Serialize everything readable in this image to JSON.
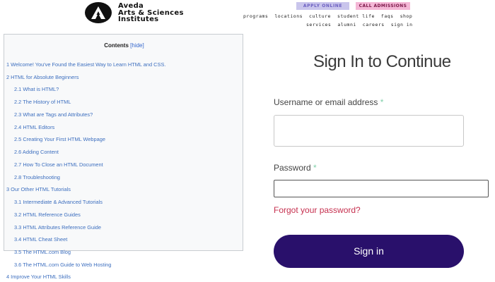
{
  "header": {
    "logo_line1": "Aveda",
    "logo_line2": "Arts & Sciences",
    "logo_line3": "Institutes",
    "apply_label": "APPLY ONLINE",
    "call_label": "CALL ADMISSIONS",
    "nav_row1": [
      "programs",
      "locations",
      "culture",
      "student life",
      "faqs",
      "shop"
    ],
    "nav_row2": [
      "services",
      "alumni",
      "careers",
      "sign in"
    ],
    "colors": {
      "apply_bg": "#c9c5ec",
      "call_bg": "#f4b7d6"
    }
  },
  "toc": {
    "title": "Contents",
    "hide_label": "[hide]",
    "items": [
      "1 Welcome! You've Found the Easiest Way to Learn HTML and CSS.",
      "2 HTML for Absolute Beginners",
      "2.1 What is HTML?",
      "2.2 The History of HTML",
      "2.3 What are Tags and Attributes?",
      "2.4 HTML Editors",
      "2.5 Creating Your First HTML Webpage",
      "2.6 Adding Content",
      "2.7 How To Close an HTML Document",
      "2.8 Troubleshooting",
      "3 Our Other HTML Tutorials",
      "3.1 Intermediate & Advanced Tutorials",
      "3.2 HTML Reference Guides",
      "3.3 HTML Attributes Reference Guide",
      "3.4 HTML Cheat Sheet",
      "3.5 The HTML.com Blog",
      "3.6 The HTML.com Guide to Web Hosting",
      "4 Improve Your HTML Skills"
    ]
  },
  "signin": {
    "title": "Sign In to Continue",
    "username_label": "Username or email address",
    "password_label": "Password",
    "required_mark": "*",
    "username_value": "",
    "password_value": "",
    "forgot_label": "Forgot your password?",
    "button_label": "Sign in",
    "colors": {
      "button": "#29106b",
      "forgot": "#c6304f"
    }
  }
}
